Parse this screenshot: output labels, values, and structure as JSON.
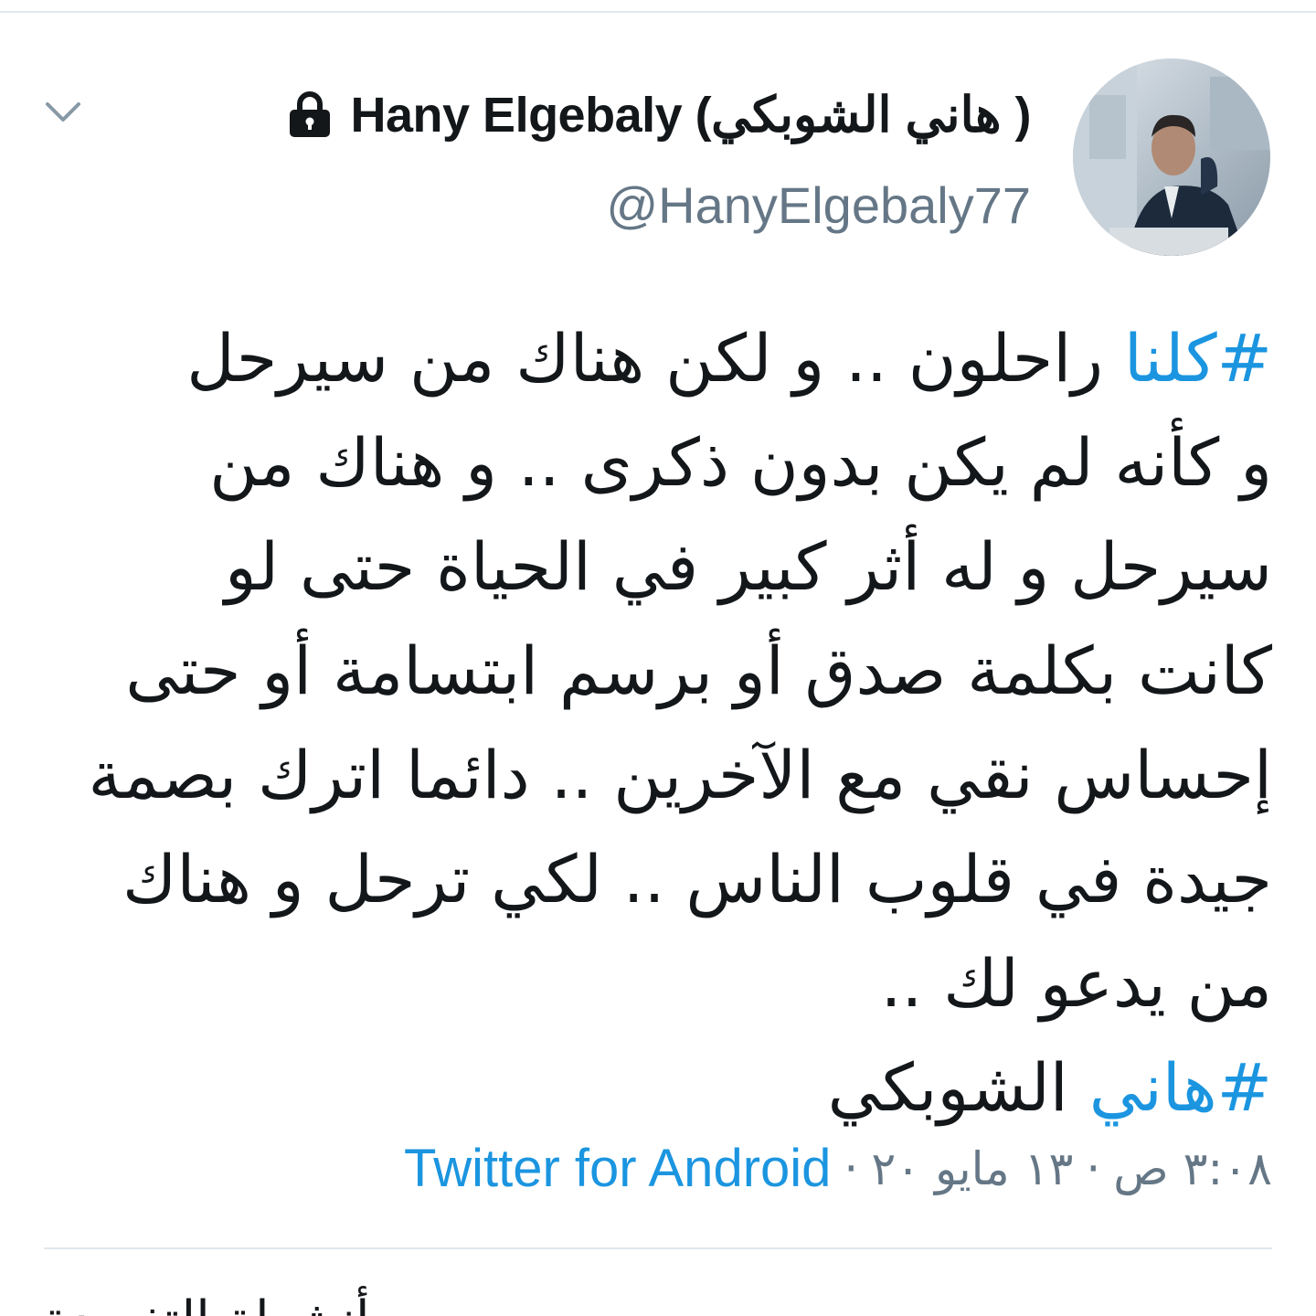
{
  "tweet": {
    "display_name": "Hany Elgebaly (هاني الشوبكي )",
    "handle": "@HanyElgebaly77",
    "body_lines": [
      {
        "hashtag": "#كلنا",
        "text": " راحلون .. و لكن هناك من سيرحل"
      },
      {
        "hashtag": "",
        "text": "و كأنه لم يكن بدون ذكرى  .. و هناك من"
      },
      {
        "hashtag": "",
        "text": "سيرحل و له أثر كبير في الحياة حتى لو"
      },
      {
        "hashtag": "",
        "text": "كانت بكلمة صدق أو برسم ابتسامة  أو حتى"
      },
      {
        "hashtag": "",
        "text": "إحساس نقي مع الآخرين .. دائما اترك بصمة"
      },
      {
        "hashtag": "",
        "text": "جيدة في قلوب الناس .. لكي ترحل و هناك"
      },
      {
        "hashtag": "",
        "text": "من يدعو لك .."
      },
      {
        "hashtag": "#هاني",
        "text": " الشوبكي"
      }
    ],
    "time": "٣:٠٨ ص",
    "date": "١٣ مايو ٢٠",
    "separator": "·",
    "source": "Twitter for Android",
    "next_section_partial": "... أنشطة التغريدة"
  },
  "icons": {
    "lock": "lock-icon",
    "chevron": "chevron-down-icon"
  },
  "colors": {
    "link": "#1b95e0",
    "text": "#14171a",
    "secondary": "#657786",
    "divider": "#e1e8ed"
  }
}
